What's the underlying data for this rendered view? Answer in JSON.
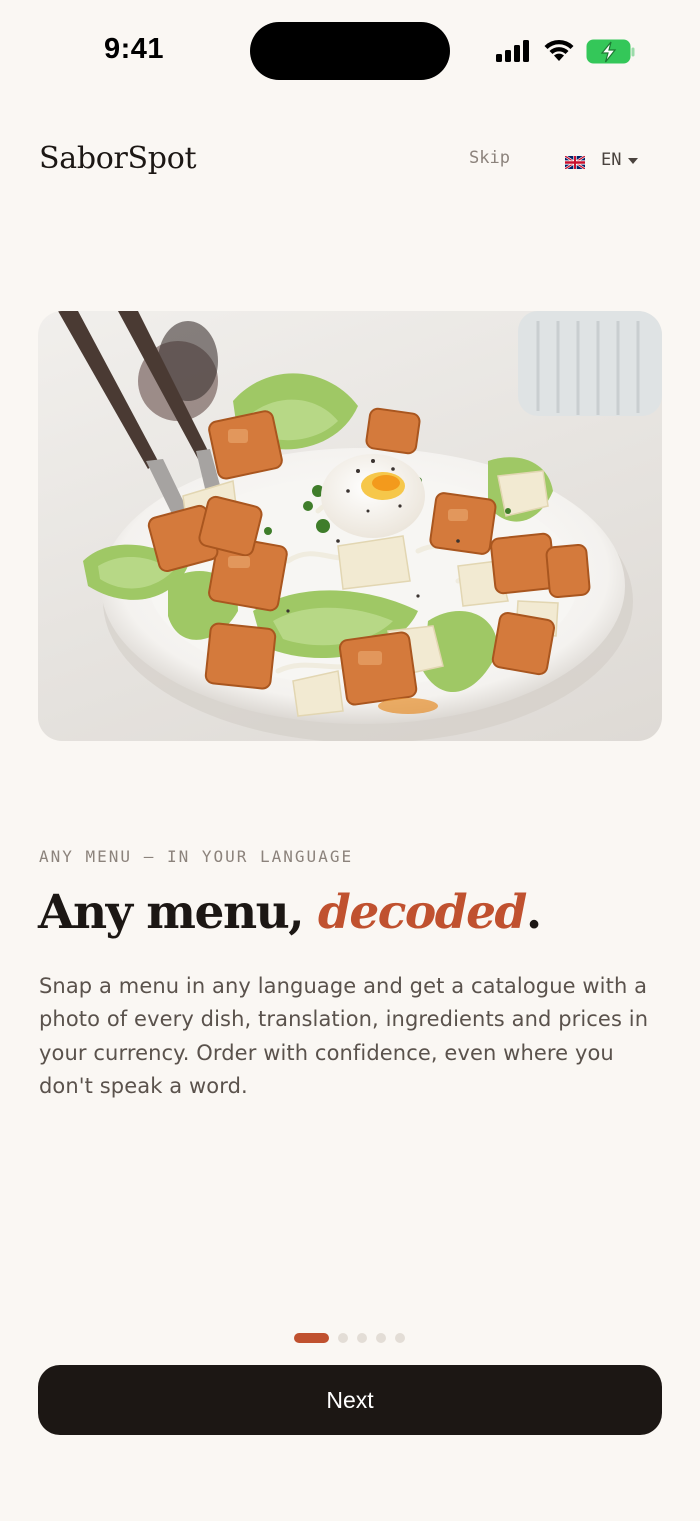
{
  "status_bar": {
    "time": "9:41"
  },
  "header": {
    "brand": "SaborSpot",
    "skip_label": "Skip",
    "language": {
      "code": "EN",
      "flag_icon": "uk-flag-icon"
    }
  },
  "hero": {
    "image_subject": "caesar-salad-photo"
  },
  "content": {
    "eyebrow": "ANY MENU — IN YOUR LANGUAGE",
    "headline_main": "Any menu, ",
    "headline_accent": "decoded",
    "headline_end": ".",
    "body": "Snap a menu in any language and get a catalogue with a photo of every dish, translation, ingredients and prices in your currency. Order with confidence, even where you don't speak a word."
  },
  "pagination": {
    "total": 5,
    "current": 1
  },
  "actions": {
    "next_label": "Next"
  },
  "colors": {
    "background": "#faf7f3",
    "accent": "#c0512f",
    "primary_button": "#1c1714",
    "battery_green": "#34c759"
  }
}
